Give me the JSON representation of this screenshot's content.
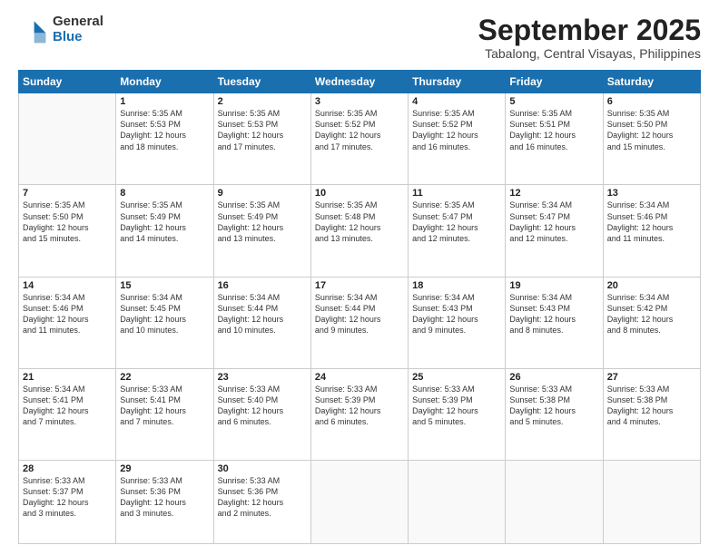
{
  "logo": {
    "general": "General",
    "blue": "Blue"
  },
  "header": {
    "month": "September 2025",
    "location": "Tabalong, Central Visayas, Philippines"
  },
  "weekdays": [
    "Sunday",
    "Monday",
    "Tuesday",
    "Wednesday",
    "Thursday",
    "Friday",
    "Saturday"
  ],
  "weeks": [
    [
      {
        "day": "",
        "info": ""
      },
      {
        "day": "1",
        "info": "Sunrise: 5:35 AM\nSunset: 5:53 PM\nDaylight: 12 hours\nand 18 minutes."
      },
      {
        "day": "2",
        "info": "Sunrise: 5:35 AM\nSunset: 5:53 PM\nDaylight: 12 hours\nand 17 minutes."
      },
      {
        "day": "3",
        "info": "Sunrise: 5:35 AM\nSunset: 5:52 PM\nDaylight: 12 hours\nand 17 minutes."
      },
      {
        "day": "4",
        "info": "Sunrise: 5:35 AM\nSunset: 5:52 PM\nDaylight: 12 hours\nand 16 minutes."
      },
      {
        "day": "5",
        "info": "Sunrise: 5:35 AM\nSunset: 5:51 PM\nDaylight: 12 hours\nand 16 minutes."
      },
      {
        "day": "6",
        "info": "Sunrise: 5:35 AM\nSunset: 5:50 PM\nDaylight: 12 hours\nand 15 minutes."
      }
    ],
    [
      {
        "day": "7",
        "info": "Sunrise: 5:35 AM\nSunset: 5:50 PM\nDaylight: 12 hours\nand 15 minutes."
      },
      {
        "day": "8",
        "info": "Sunrise: 5:35 AM\nSunset: 5:49 PM\nDaylight: 12 hours\nand 14 minutes."
      },
      {
        "day": "9",
        "info": "Sunrise: 5:35 AM\nSunset: 5:49 PM\nDaylight: 12 hours\nand 13 minutes."
      },
      {
        "day": "10",
        "info": "Sunrise: 5:35 AM\nSunset: 5:48 PM\nDaylight: 12 hours\nand 13 minutes."
      },
      {
        "day": "11",
        "info": "Sunrise: 5:35 AM\nSunset: 5:47 PM\nDaylight: 12 hours\nand 12 minutes."
      },
      {
        "day": "12",
        "info": "Sunrise: 5:34 AM\nSunset: 5:47 PM\nDaylight: 12 hours\nand 12 minutes."
      },
      {
        "day": "13",
        "info": "Sunrise: 5:34 AM\nSunset: 5:46 PM\nDaylight: 12 hours\nand 11 minutes."
      }
    ],
    [
      {
        "day": "14",
        "info": "Sunrise: 5:34 AM\nSunset: 5:46 PM\nDaylight: 12 hours\nand 11 minutes."
      },
      {
        "day": "15",
        "info": "Sunrise: 5:34 AM\nSunset: 5:45 PM\nDaylight: 12 hours\nand 10 minutes."
      },
      {
        "day": "16",
        "info": "Sunrise: 5:34 AM\nSunset: 5:44 PM\nDaylight: 12 hours\nand 10 minutes."
      },
      {
        "day": "17",
        "info": "Sunrise: 5:34 AM\nSunset: 5:44 PM\nDaylight: 12 hours\nand 9 minutes."
      },
      {
        "day": "18",
        "info": "Sunrise: 5:34 AM\nSunset: 5:43 PM\nDaylight: 12 hours\nand 9 minutes."
      },
      {
        "day": "19",
        "info": "Sunrise: 5:34 AM\nSunset: 5:43 PM\nDaylight: 12 hours\nand 8 minutes."
      },
      {
        "day": "20",
        "info": "Sunrise: 5:34 AM\nSunset: 5:42 PM\nDaylight: 12 hours\nand 8 minutes."
      }
    ],
    [
      {
        "day": "21",
        "info": "Sunrise: 5:34 AM\nSunset: 5:41 PM\nDaylight: 12 hours\nand 7 minutes."
      },
      {
        "day": "22",
        "info": "Sunrise: 5:33 AM\nSunset: 5:41 PM\nDaylight: 12 hours\nand 7 minutes."
      },
      {
        "day": "23",
        "info": "Sunrise: 5:33 AM\nSunset: 5:40 PM\nDaylight: 12 hours\nand 6 minutes."
      },
      {
        "day": "24",
        "info": "Sunrise: 5:33 AM\nSunset: 5:39 PM\nDaylight: 12 hours\nand 6 minutes."
      },
      {
        "day": "25",
        "info": "Sunrise: 5:33 AM\nSunset: 5:39 PM\nDaylight: 12 hours\nand 5 minutes."
      },
      {
        "day": "26",
        "info": "Sunrise: 5:33 AM\nSunset: 5:38 PM\nDaylight: 12 hours\nand 5 minutes."
      },
      {
        "day": "27",
        "info": "Sunrise: 5:33 AM\nSunset: 5:38 PM\nDaylight: 12 hours\nand 4 minutes."
      }
    ],
    [
      {
        "day": "28",
        "info": "Sunrise: 5:33 AM\nSunset: 5:37 PM\nDaylight: 12 hours\nand 3 minutes."
      },
      {
        "day": "29",
        "info": "Sunrise: 5:33 AM\nSunset: 5:36 PM\nDaylight: 12 hours\nand 3 minutes."
      },
      {
        "day": "30",
        "info": "Sunrise: 5:33 AM\nSunset: 5:36 PM\nDaylight: 12 hours\nand 2 minutes."
      },
      {
        "day": "",
        "info": ""
      },
      {
        "day": "",
        "info": ""
      },
      {
        "day": "",
        "info": ""
      },
      {
        "day": "",
        "info": ""
      }
    ]
  ]
}
